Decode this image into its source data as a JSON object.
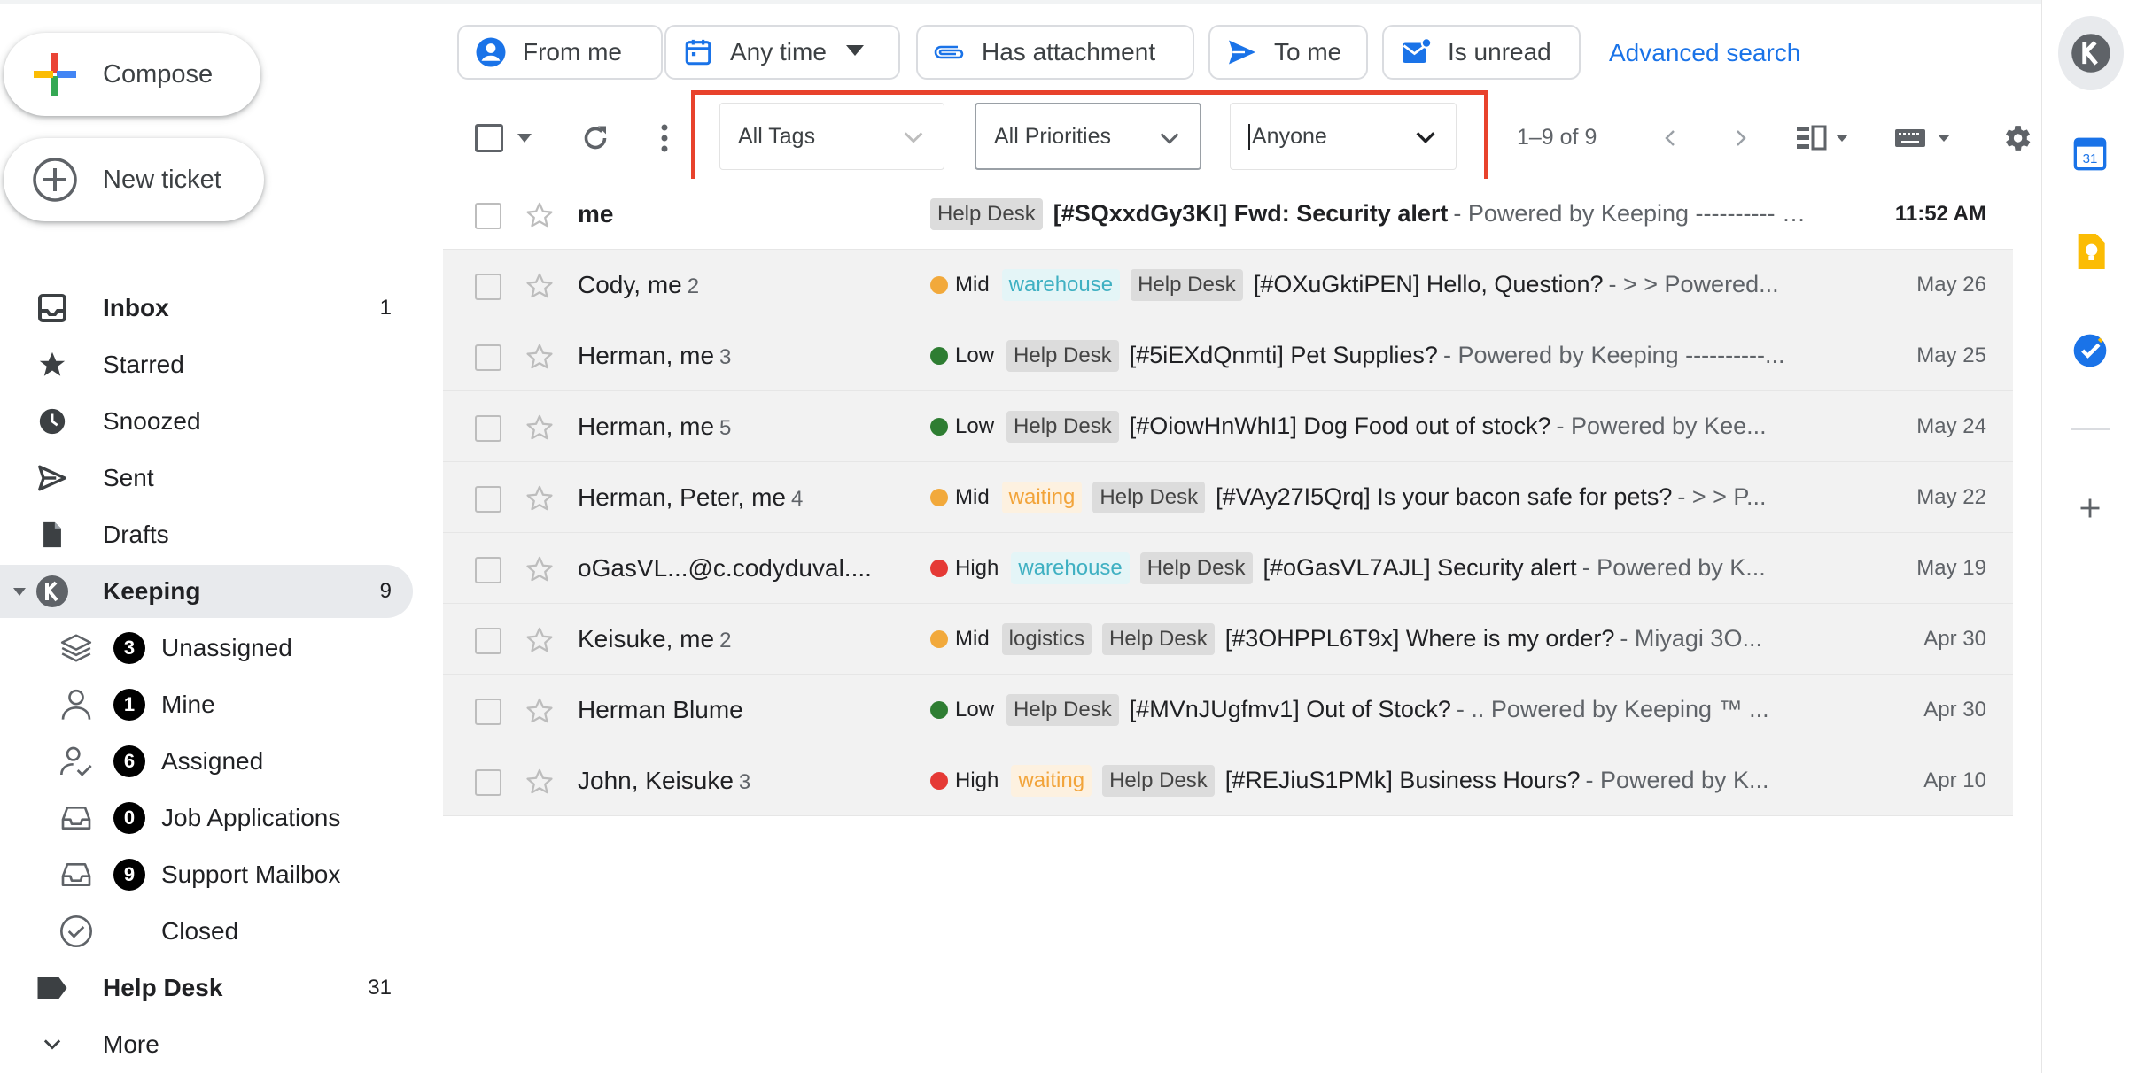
{
  "sidebar": {
    "compose_label": "Compose",
    "new_ticket_label": "New ticket",
    "items": [
      {
        "label": "Inbox",
        "count": "1"
      },
      {
        "label": "Starred",
        "count": ""
      },
      {
        "label": "Snoozed",
        "count": ""
      },
      {
        "label": "Sent",
        "count": ""
      },
      {
        "label": "Drafts",
        "count": ""
      },
      {
        "label": "Keeping",
        "count": "9"
      }
    ],
    "keeping_sub": [
      {
        "label": "Unassigned",
        "badge": "3"
      },
      {
        "label": "Mine",
        "badge": "1"
      },
      {
        "label": "Assigned",
        "badge": "6"
      },
      {
        "label": "Job Applications",
        "badge": "0"
      },
      {
        "label": "Support Mailbox",
        "badge": "9"
      },
      {
        "label": "Closed",
        "badge": ""
      }
    ],
    "helpdesk": {
      "label": "Help Desk",
      "count": "31"
    },
    "more_label": "More"
  },
  "filters": {
    "chips": [
      "From me",
      "Any time",
      "Has attachment",
      "To me",
      "Is unread"
    ],
    "advanced_search": "Advanced search"
  },
  "toolbar": {
    "tags_dropdown": "All Tags",
    "priorities_dropdown": "All Priorities",
    "assignee_dropdown": "Anyone",
    "page_range": "1–9 of 9"
  },
  "emails": [
    {
      "sender": "me",
      "count": "",
      "priority": "",
      "tags": [
        "Help Desk"
      ],
      "subject": "[#SQxxdGy3KI] Fwd: Security alert",
      "snippet": "- Powered by Keeping ---------- R...",
      "date": "11:52 AM",
      "unread": true
    },
    {
      "sender": "Cody, me",
      "count": "2",
      "priority": "Mid",
      "tags": [
        "warehouse",
        "Help Desk"
      ],
      "subject": "[#OXuGktiPEN] Hello, Question?",
      "snippet": "- > > Powered...",
      "date": "May 26",
      "unread": false
    },
    {
      "sender": "Herman, me",
      "count": "3",
      "priority": "Low",
      "tags": [
        "Help Desk"
      ],
      "subject": "[#5iEXdQnmti] Pet Supplies?",
      "snippet": "- Powered by Keeping ----------...",
      "date": "May 25",
      "unread": false
    },
    {
      "sender": "Herman, me",
      "count": "5",
      "priority": "Low",
      "tags": [
        "Help Desk"
      ],
      "subject": "[#OiowHnWhI1] Dog Food out of stock?",
      "snippet": "- Powered by Kee...",
      "date": "May 24",
      "unread": false
    },
    {
      "sender": "Herman, Peter, me",
      "count": "4",
      "priority": "Mid",
      "tags": [
        "waiting",
        "Help Desk"
      ],
      "subject": "[#VAy27I5Qrq] Is your bacon safe for pets?",
      "snippet": "- > > P...",
      "date": "May 22",
      "unread": false
    },
    {
      "sender": "oGasVL...@c.codyduval....",
      "count": "",
      "priority": "High",
      "tags": [
        "warehouse",
        "Help Desk"
      ],
      "subject": "[#oGasVL7AJL] Security alert",
      "snippet": "- Powered by K...",
      "date": "May 19",
      "unread": false
    },
    {
      "sender": "Keisuke, me",
      "count": "2",
      "priority": "Mid",
      "tags": [
        "logistics",
        "Help Desk"
      ],
      "subject": "[#3OHPPL6T9x] Where is my order?",
      "snippet": "- Miyagi 3O...",
      "date": "Apr 30",
      "unread": false
    },
    {
      "sender": "Herman Blume",
      "count": "",
      "priority": "Low",
      "tags": [
        "Help Desk"
      ],
      "subject": "[#MVnJUgfmv1] Out of Stock?",
      "snippet": "- .. Powered by Keeping ™ ...",
      "date": "Apr 30",
      "unread": false
    },
    {
      "sender": "John, Keisuke",
      "count": "3",
      "priority": "High",
      "tags": [
        "waiting",
        "Help Desk"
      ],
      "subject": "[#REJiuS1PMk] Business Hours?",
      "snippet": "- Powered by K...",
      "date": "Apr 10",
      "unread": false
    }
  ],
  "priority_colors": {
    "Low": "#2e7d32",
    "Mid": "#f2a93b",
    "High": "#e53935"
  },
  "tag_styles": {
    "Help Desk": "tag-hd",
    "warehouse": "tag-wh",
    "waiting": "tag-wait",
    "logistics": "tag-log"
  },
  "colors": {
    "accent": "#1a73e8",
    "highlight": "#e8422c"
  },
  "side_panel": {
    "calendar_day": "31"
  }
}
